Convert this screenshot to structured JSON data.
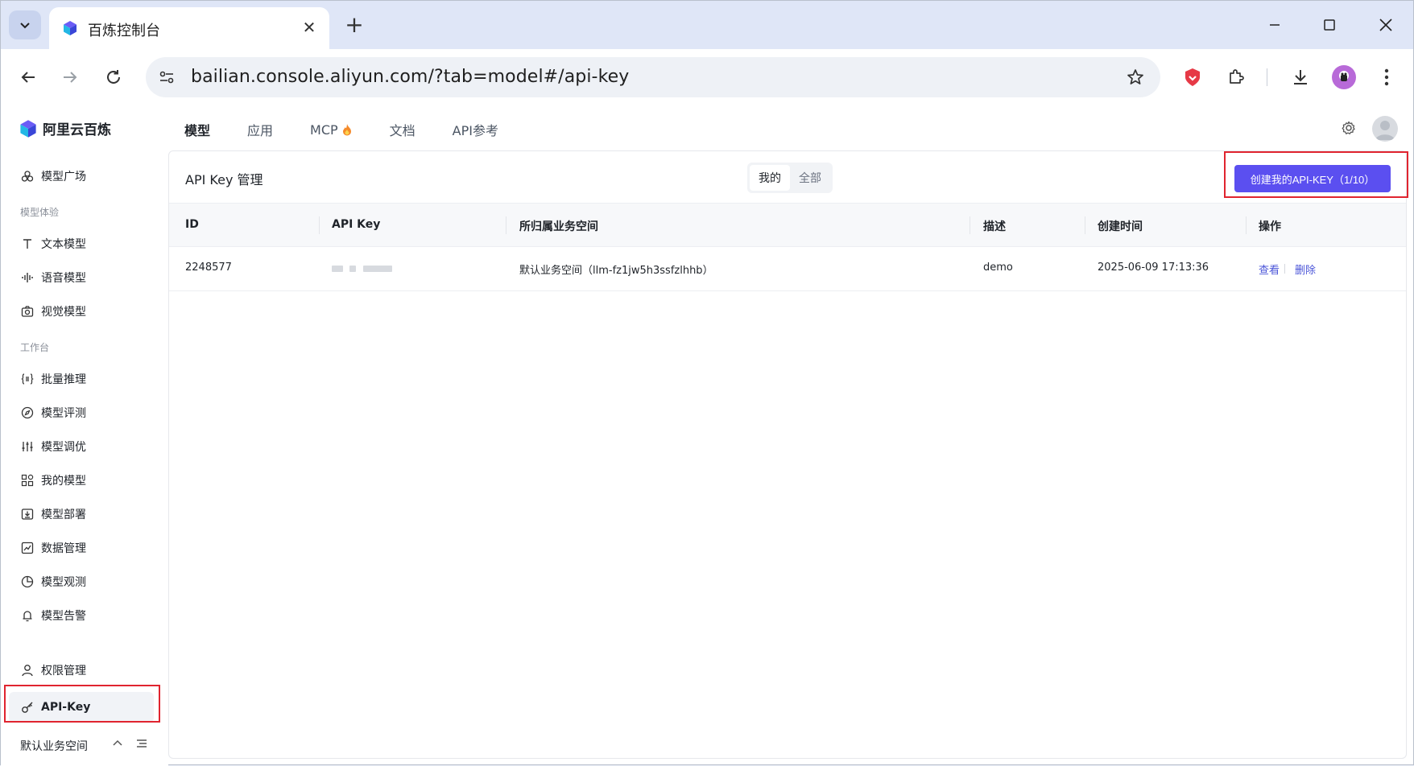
{
  "browser": {
    "tab_title": "百炼控制台",
    "url": "bailian.console.aliyun.com/?tab=model#/api-key"
  },
  "app": {
    "logo_text": "阿里云百炼",
    "topnav": [
      {
        "label": "模型"
      },
      {
        "label": "应用"
      },
      {
        "label": "MCP"
      },
      {
        "label": "文档"
      },
      {
        "label": "API参考"
      }
    ]
  },
  "sidebar": {
    "model_square": "模型广场",
    "group_experience": "模型体验",
    "text_model": "文本模型",
    "voice_model": "语音模型",
    "vision_model": "视觉模型",
    "group_workbench": "工作台",
    "batch_inference": "批量推理",
    "model_eval": "模型评测",
    "model_tuning": "模型调优",
    "my_models": "我的模型",
    "model_deploy": "模型部署",
    "data_management": "数据管理",
    "model_observe": "模型观测",
    "model_alert": "模型告警",
    "permissions": "权限管理",
    "api_key": "API-Key",
    "workspace": "默认业务空间"
  },
  "main": {
    "title": "API Key 管理",
    "filter": {
      "mine": "我的",
      "all": "全部"
    },
    "create_button": "创建我的API-KEY（1/10）",
    "columns": {
      "id": "ID",
      "api_key": "API Key",
      "workspace": "所归属业务空间",
      "desc": "描述",
      "created": "创建时间",
      "actions": "操作"
    },
    "rows": [
      {
        "id": "2248577",
        "workspace": "默认业务空间（llm-fz1jw5h3ssfzlhhb）",
        "desc": "demo",
        "created": "2025-06-09 17:13:36",
        "view": "查看",
        "delete": "删除"
      }
    ]
  },
  "colors": {
    "primary": "#5b4ff0",
    "link": "#4b55d8",
    "highlight_box": "#e0242f"
  }
}
